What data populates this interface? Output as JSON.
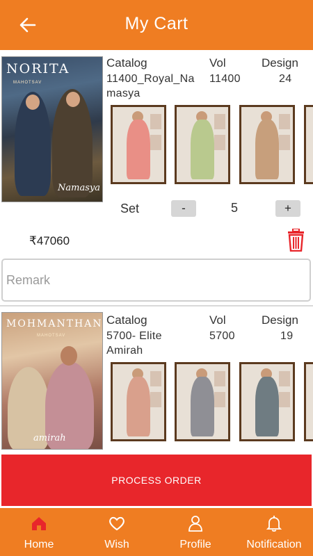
{
  "header": {
    "title": "My Cart"
  },
  "cart": {
    "column_headers": {
      "catalog": "Catalog",
      "vol": "Vol",
      "design": "Design"
    },
    "items": [
      {
        "cover_brand": "NORITA",
        "cover_script": "Namasya",
        "catalog_line1": "11400_Royal_Na",
        "catalog_line2": "masya",
        "vol": "11400",
        "design": "24",
        "set_label": "Set",
        "minus_label": "-",
        "quantity": "5",
        "plus_label": "+",
        "price": "₹47060",
        "remark_placeholder": "Remark",
        "thumb_colors": [
          "#e98f86",
          "#b9c98e",
          "#c79f7c"
        ]
      },
      {
        "cover_brand": "MOHMANTHAN",
        "cover_script": "amirah",
        "catalog_line1": "5700- Elite",
        "catalog_line2": "Amirah",
        "vol": "5700",
        "design": "19",
        "thumb_colors": [
          "#d9a08c",
          "#8f8f95",
          "#6f7c82"
        ]
      }
    ]
  },
  "process_order_label": "PROCESS ORDER",
  "bottom_nav": [
    {
      "label": "Home",
      "icon": "home-icon"
    },
    {
      "label": "Wish",
      "icon": "heart-icon"
    },
    {
      "label": "Profile",
      "icon": "user-icon"
    },
    {
      "label": "Notification",
      "icon": "bell-icon"
    }
  ],
  "colors": {
    "primary": "#ef7d22",
    "danger": "#e8262b",
    "delete": "#e8262b",
    "active_nav": "#e8262b"
  }
}
